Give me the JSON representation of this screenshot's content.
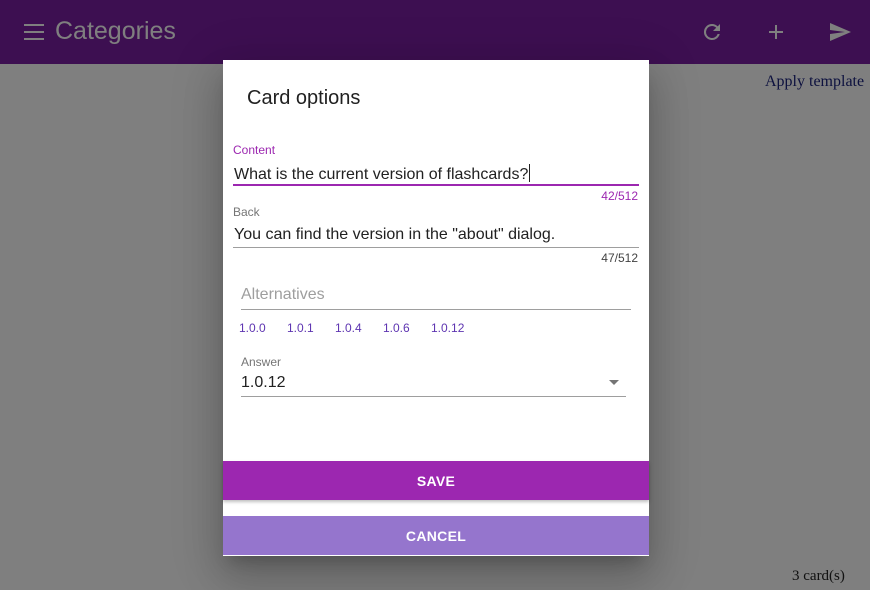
{
  "appbar": {
    "title": "Categories",
    "menu_icon": "menu-icon",
    "actions": [
      {
        "name": "refresh-icon"
      },
      {
        "name": "add-icon"
      },
      {
        "name": "send-icon"
      }
    ]
  },
  "background": {
    "apply_template": "Apply template",
    "card_count": "3 card(s)"
  },
  "dialog": {
    "title": "Card options",
    "content": {
      "label": "Content",
      "value": "What is the current version of flashcards?",
      "counter": "42/512"
    },
    "back": {
      "label": "Back",
      "value": "You can find the version in the \"about\" dialog.",
      "counter": "47/512"
    },
    "alternatives": {
      "placeholder": "Alternatives",
      "chips": [
        "1.0.0",
        "1.0.1",
        "1.0.4",
        "1.0.6",
        "1.0.12"
      ]
    },
    "answer": {
      "label": "Answer",
      "value": "1.0.12"
    },
    "save_label": "SAVE",
    "cancel_label": "CANCEL"
  },
  "colors": {
    "primary": "#9c27b0",
    "appbar": "#7b1fa2",
    "cancel": "#9575cd",
    "chip_text": "#5e35b1"
  }
}
